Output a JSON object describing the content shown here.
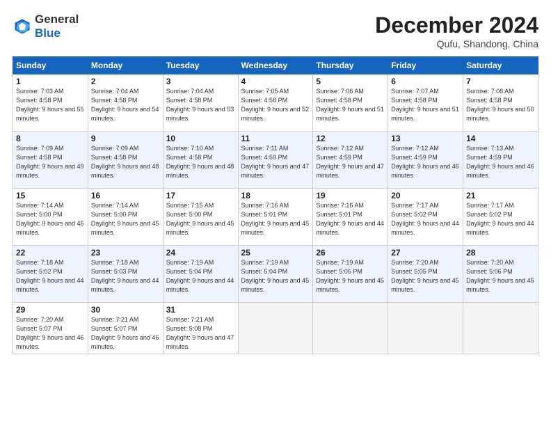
{
  "header": {
    "logo_general": "General",
    "logo_blue": "Blue",
    "month_title": "December 2024",
    "location": "Qufu, Shandong, China"
  },
  "days_of_week": [
    "Sunday",
    "Monday",
    "Tuesday",
    "Wednesday",
    "Thursday",
    "Friday",
    "Saturday"
  ],
  "weeks": [
    [
      {
        "day": "1",
        "sunrise": "Sunrise: 7:03 AM",
        "sunset": "Sunset: 4:58 PM",
        "daylight": "Daylight: 9 hours and 55 minutes."
      },
      {
        "day": "2",
        "sunrise": "Sunrise: 7:04 AM",
        "sunset": "Sunset: 4:58 PM",
        "daylight": "Daylight: 9 hours and 54 minutes."
      },
      {
        "day": "3",
        "sunrise": "Sunrise: 7:04 AM",
        "sunset": "Sunset: 4:58 PM",
        "daylight": "Daylight: 9 hours and 53 minutes."
      },
      {
        "day": "4",
        "sunrise": "Sunrise: 7:05 AM",
        "sunset": "Sunset: 4:58 PM",
        "daylight": "Daylight: 9 hours and 52 minutes."
      },
      {
        "day": "5",
        "sunrise": "Sunrise: 7:06 AM",
        "sunset": "Sunset: 4:58 PM",
        "daylight": "Daylight: 9 hours and 51 minutes."
      },
      {
        "day": "6",
        "sunrise": "Sunrise: 7:07 AM",
        "sunset": "Sunset: 4:58 PM",
        "daylight": "Daylight: 9 hours and 51 minutes."
      },
      {
        "day": "7",
        "sunrise": "Sunrise: 7:08 AM",
        "sunset": "Sunset: 4:58 PM",
        "daylight": "Daylight: 9 hours and 50 minutes."
      }
    ],
    [
      {
        "day": "8",
        "sunrise": "Sunrise: 7:09 AM",
        "sunset": "Sunset: 4:58 PM",
        "daylight": "Daylight: 9 hours and 49 minutes."
      },
      {
        "day": "9",
        "sunrise": "Sunrise: 7:09 AM",
        "sunset": "Sunset: 4:58 PM",
        "daylight": "Daylight: 9 hours and 48 minutes."
      },
      {
        "day": "10",
        "sunrise": "Sunrise: 7:10 AM",
        "sunset": "Sunset: 4:58 PM",
        "daylight": "Daylight: 9 hours and 48 minutes."
      },
      {
        "day": "11",
        "sunrise": "Sunrise: 7:11 AM",
        "sunset": "Sunset: 4:59 PM",
        "daylight": "Daylight: 9 hours and 47 minutes."
      },
      {
        "day": "12",
        "sunrise": "Sunrise: 7:12 AM",
        "sunset": "Sunset: 4:59 PM",
        "daylight": "Daylight: 9 hours and 47 minutes."
      },
      {
        "day": "13",
        "sunrise": "Sunrise: 7:12 AM",
        "sunset": "Sunset: 4:59 PM",
        "daylight": "Daylight: 9 hours and 46 minutes."
      },
      {
        "day": "14",
        "sunrise": "Sunrise: 7:13 AM",
        "sunset": "Sunset: 4:59 PM",
        "daylight": "Daylight: 9 hours and 46 minutes."
      }
    ],
    [
      {
        "day": "15",
        "sunrise": "Sunrise: 7:14 AM",
        "sunset": "Sunset: 5:00 PM",
        "daylight": "Daylight: 9 hours and 45 minutes."
      },
      {
        "day": "16",
        "sunrise": "Sunrise: 7:14 AM",
        "sunset": "Sunset: 5:00 PM",
        "daylight": "Daylight: 9 hours and 45 minutes."
      },
      {
        "day": "17",
        "sunrise": "Sunrise: 7:15 AM",
        "sunset": "Sunset: 5:00 PM",
        "daylight": "Daylight: 9 hours and 45 minutes."
      },
      {
        "day": "18",
        "sunrise": "Sunrise: 7:16 AM",
        "sunset": "Sunset: 5:01 PM",
        "daylight": "Daylight: 9 hours and 45 minutes."
      },
      {
        "day": "19",
        "sunrise": "Sunrise: 7:16 AM",
        "sunset": "Sunset: 5:01 PM",
        "daylight": "Daylight: 9 hours and 44 minutes."
      },
      {
        "day": "20",
        "sunrise": "Sunrise: 7:17 AM",
        "sunset": "Sunset: 5:02 PM",
        "daylight": "Daylight: 9 hours and 44 minutes."
      },
      {
        "day": "21",
        "sunrise": "Sunrise: 7:17 AM",
        "sunset": "Sunset: 5:02 PM",
        "daylight": "Daylight: 9 hours and 44 minutes."
      }
    ],
    [
      {
        "day": "22",
        "sunrise": "Sunrise: 7:18 AM",
        "sunset": "Sunset: 5:02 PM",
        "daylight": "Daylight: 9 hours and 44 minutes."
      },
      {
        "day": "23",
        "sunrise": "Sunrise: 7:18 AM",
        "sunset": "Sunset: 5:03 PM",
        "daylight": "Daylight: 9 hours and 44 minutes."
      },
      {
        "day": "24",
        "sunrise": "Sunrise: 7:19 AM",
        "sunset": "Sunset: 5:04 PM",
        "daylight": "Daylight: 9 hours and 44 minutes."
      },
      {
        "day": "25",
        "sunrise": "Sunrise: 7:19 AM",
        "sunset": "Sunset: 5:04 PM",
        "daylight": "Daylight: 9 hours and 45 minutes."
      },
      {
        "day": "26",
        "sunrise": "Sunrise: 7:19 AM",
        "sunset": "Sunset: 5:05 PM",
        "daylight": "Daylight: 9 hours and 45 minutes."
      },
      {
        "day": "27",
        "sunrise": "Sunrise: 7:20 AM",
        "sunset": "Sunset: 5:05 PM",
        "daylight": "Daylight: 9 hours and 45 minutes."
      },
      {
        "day": "28",
        "sunrise": "Sunrise: 7:20 AM",
        "sunset": "Sunset: 5:06 PM",
        "daylight": "Daylight: 9 hours and 45 minutes."
      }
    ],
    [
      {
        "day": "29",
        "sunrise": "Sunrise: 7:20 AM",
        "sunset": "Sunset: 5:07 PM",
        "daylight": "Daylight: 9 hours and 46 minutes."
      },
      {
        "day": "30",
        "sunrise": "Sunrise: 7:21 AM",
        "sunset": "Sunset: 5:07 PM",
        "daylight": "Daylight: 9 hours and 46 minutes."
      },
      {
        "day": "31",
        "sunrise": "Sunrise: 7:21 AM",
        "sunset": "Sunset: 5:08 PM",
        "daylight": "Daylight: 9 hours and 47 minutes."
      },
      null,
      null,
      null,
      null
    ]
  ]
}
